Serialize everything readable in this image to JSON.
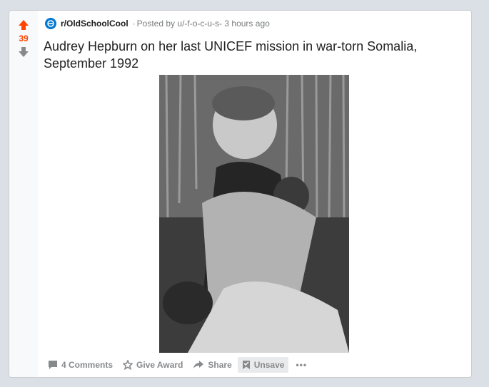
{
  "post": {
    "subreddit": "r/OldSchoolCool",
    "posted_by_prefix": "Posted by",
    "author": "u/-f-o-c-u-s-",
    "time_ago": "3 hours ago",
    "title": "Audrey Hepburn on her last UNICEF mission in war-torn Somalia, September 1992",
    "score": "39",
    "image_alt": "Black and white photo of Audrey Hepburn holding a child"
  },
  "actions": {
    "comments": "4 Comments",
    "award": "Give Award",
    "share": "Share",
    "unsave": "Unsave",
    "more": "•••"
  },
  "colors": {
    "upvote": "#ff4500",
    "downvote": "#878a8c",
    "subreddit_icon": "#0079d3",
    "background": "#dae0e6"
  }
}
